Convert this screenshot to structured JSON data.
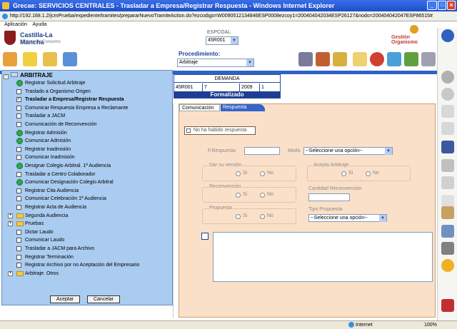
{
  "window": {
    "title": "Grecae: SERVICIOS CENTRALES - Trasladar a Empresa/Registrar Respuesta - Windows Internet Explorer",
    "url": "http://192.168.1.2/jcmPrueba/expediente/tramites/prepararNuevoTramiteAction.do?ezcodigo=W0090512134846ESP0008ezcoy1=200404042034ESP26127&nodo=200404042047ESP86515#"
  },
  "menubar": [
    "Aplicación",
    "Ayuda"
  ],
  "header": {
    "logo_name": "Castilla-La Mancha",
    "logo_sub": "Instituto de Consumo",
    "espcoal_label": "ESPCOAL",
    "espcoal_value": "45R001",
    "gestion_label": "Gestión Organismo"
  },
  "toolbar": {
    "procedimiento_label": "Procedimiento:",
    "procedimiento_value": "Arbitraje"
  },
  "demanda": {
    "title": "DEMANDA",
    "cells": [
      "45R001",
      "7",
      "2009",
      "1"
    ],
    "status": "Formalizado"
  },
  "tree": {
    "root": "ARBITRAJE",
    "items": [
      {
        "label": "Registrar Solicitud Arbitraje",
        "icon": "green"
      },
      {
        "label": "Traslado a Organismo Origen",
        "icon": "box"
      },
      {
        "label": "Trasladar a Empresa/Registrar Respuesta",
        "icon": "check",
        "bold": true
      },
      {
        "label": "Comunicar Respuesta Empresa a Reclamante",
        "icon": "box"
      },
      {
        "label": "Trasladar a JACM",
        "icon": "box"
      },
      {
        "label": "Comunicación de Reconvención",
        "icon": "box"
      },
      {
        "label": "Registrar Admisión",
        "icon": "green"
      },
      {
        "label": "Comunicar Admisión",
        "icon": "green"
      },
      {
        "label": "Registrar Inadmisión",
        "icon": "box"
      },
      {
        "label": "Comunicar Inadmisión",
        "icon": "box"
      },
      {
        "label": "Designar Colegio Arbitral. 1ª Audiencia",
        "icon": "green"
      },
      {
        "label": "Trasladar a Centro Colaborador",
        "icon": "box"
      },
      {
        "label": "Comunicar Designación Colegio Arbitral",
        "icon": "green"
      },
      {
        "label": "Registrar Cita Audiencia",
        "icon": "box"
      },
      {
        "label": "Comunicar Celebración 1ª Audiencia",
        "icon": "box"
      },
      {
        "label": "Registrar Acta de Audiencia",
        "icon": "box"
      },
      {
        "label": "Segunda Audiencia",
        "icon": "folder"
      },
      {
        "label": "Pruebas",
        "icon": "folder"
      },
      {
        "label": "Dictar Laudo",
        "icon": "box"
      },
      {
        "label": "Comunicar Laudo",
        "icon": "box"
      },
      {
        "label": "Trasladar a JACM para Archivo",
        "icon": "box"
      },
      {
        "label": "Registrar Terminación",
        "icon": "box"
      },
      {
        "label": "Registrar Archivo por no Aceptación del Empresario",
        "icon": "box"
      },
      {
        "label": "Arbitraje. Otros",
        "icon": "folder"
      }
    ],
    "accept_label": "Aceptar",
    "cancel_label": "Cancelar"
  },
  "form": {
    "tab_comunicacion": "Comunicación",
    "tab_respuesta": "Respuesta",
    "no_respuesta": "No ha habido respuesta",
    "f_respuesta": "F.Respuesta",
    "modo": "Modo",
    "modo_value": "--Seleccione una opción--",
    "dar_version": "Dar su versión",
    "acepta_arbitraje": "Acepta Arbitraje",
    "reconvencion": "Reconvención",
    "cantidad_reconvencion": "Cantidad Reconvención",
    "propuesta": "Propuesta",
    "tipo_propuesta": "Tipo Propuesta",
    "tipo_value": "--Seleccione una opción--",
    "si": "Si",
    "no": "No"
  },
  "statusbar": {
    "zone": "Internet",
    "zoom": "100%"
  }
}
